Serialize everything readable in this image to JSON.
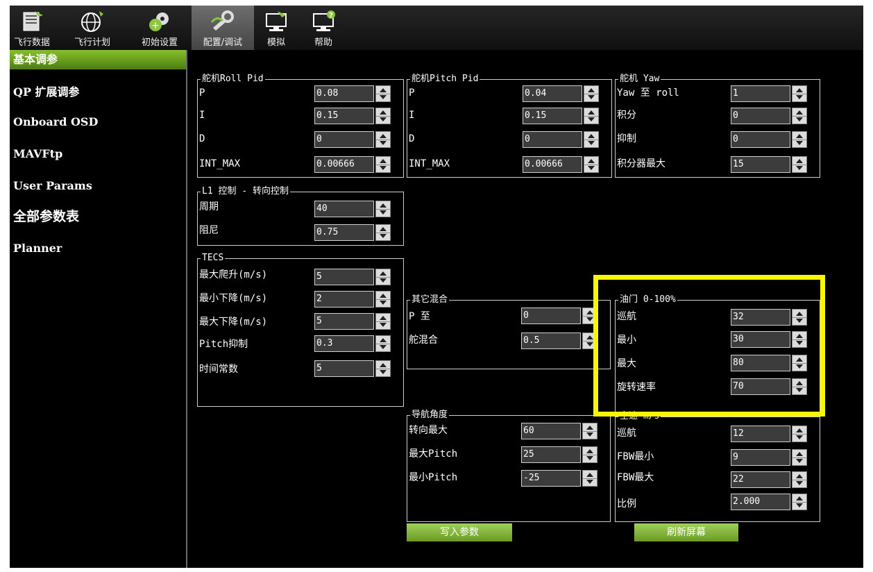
{
  "toolbar": {
    "items": [
      {
        "label": "飞行数据",
        "icon": "flight-data-icon"
      },
      {
        "label": "飞行计划",
        "icon": "flight-plan-icon"
      },
      {
        "label": "初始设置",
        "icon": "initial-setup-icon"
      },
      {
        "label": "配置/调试",
        "icon": "config-tuning-icon"
      },
      {
        "label": "模拟",
        "icon": "simulation-icon"
      },
      {
        "label": "帮助",
        "icon": "help-icon"
      }
    ]
  },
  "sidebar": {
    "items": [
      {
        "label": "基本调参"
      },
      {
        "label": "QP 扩展调参"
      },
      {
        "label": "Onboard OSD"
      },
      {
        "label": "MAVFtp"
      },
      {
        "label": "User Params"
      },
      {
        "label": "全部参数表"
      },
      {
        "label": "Planner"
      }
    ]
  },
  "roll_pid": {
    "title": "舵机Roll Pid",
    "rows": [
      {
        "label": "P",
        "value": "0.08"
      },
      {
        "label": "I",
        "value": "0.15"
      },
      {
        "label": "D",
        "value": "0"
      },
      {
        "label": "INT_MAX",
        "value": "0.00666"
      }
    ]
  },
  "pitch_pid": {
    "title": "舵机Pitch Pid",
    "rows": [
      {
        "label": "P",
        "value": "0.04"
      },
      {
        "label": "I",
        "value": "0.15"
      },
      {
        "label": "D",
        "value": "0"
      },
      {
        "label": "INT_MAX",
        "value": "0.00666"
      }
    ]
  },
  "yaw": {
    "title": "舵机 Yaw",
    "rows": [
      {
        "label": "Yaw 至 roll",
        "value": "1"
      },
      {
        "label": "积分",
        "value": "0"
      },
      {
        "label": "抑制",
        "value": "0"
      },
      {
        "label": "积分器最大",
        "value": "15"
      }
    ]
  },
  "l1": {
    "title": "L1 控制 - 转向控制",
    "rows": [
      {
        "label": "周期",
        "value": "40"
      },
      {
        "label": "阻尼",
        "value": "0.75"
      }
    ]
  },
  "tecs": {
    "title": "TECS",
    "rows": [
      {
        "label": "最大爬升(m/s)",
        "value": "5"
      },
      {
        "label": "最小下降(m/s)",
        "value": "2"
      },
      {
        "label": "最大下降(m/s)",
        "value": "5"
      },
      {
        "label": "Pitch抑制",
        "value": "0.3"
      },
      {
        "label": "时间常数",
        "value": "5"
      }
    ]
  },
  "other_mix": {
    "title": "其它混合",
    "rows": [
      {
        "label": "P 至",
        "value": "0"
      },
      {
        "label": "舵混合",
        "value": "0.5"
      }
    ]
  },
  "throttle": {
    "title": "油门 0-100%",
    "rows": [
      {
        "label": "巡航",
        "value": "32"
      },
      {
        "label": "最小",
        "value": "30"
      },
      {
        "label": "最大",
        "value": "80"
      },
      {
        "label": "旋转速率",
        "value": "70"
      }
    ]
  },
  "nav_angle": {
    "title": "导航角度",
    "rows": [
      {
        "label": "转向最大",
        "value": "60"
      },
      {
        "label": "最大Pitch",
        "value": "25"
      },
      {
        "label": "最小Pitch",
        "value": "-25"
      }
    ]
  },
  "airspeed": {
    "title": "空速 m/s",
    "rows": [
      {
        "label": "巡航",
        "value": "12"
      },
      {
        "label": "FBW最小",
        "value": "9"
      },
      {
        "label": "FBW最大",
        "value": "22"
      },
      {
        "label": "比例",
        "value": "2.000"
      }
    ]
  },
  "buttons": {
    "write_params": "写入参数",
    "refresh_screen": "刷新屏幕"
  },
  "colors": {
    "accent_green": "#7cb82a",
    "highlight_yellow": "#f7f700"
  }
}
